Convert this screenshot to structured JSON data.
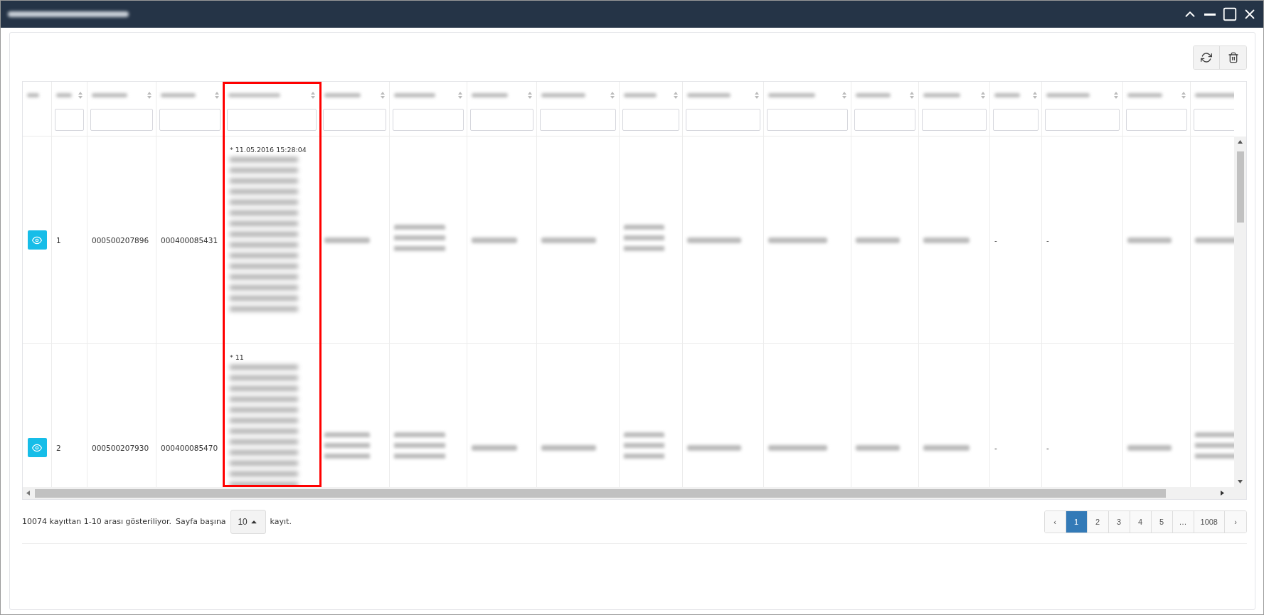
{
  "columns": [
    {
      "sortable": false,
      "filter": false,
      "highlighted": false
    },
    {
      "sortable": true,
      "filter": true,
      "highlighted": false
    },
    {
      "sortable": true,
      "filter": true,
      "highlighted": false
    },
    {
      "sortable": true,
      "filter": true,
      "highlighted": false
    },
    {
      "sortable": true,
      "filter": true,
      "highlighted": true
    },
    {
      "sortable": true,
      "filter": true,
      "highlighted": false
    },
    {
      "sortable": true,
      "filter": true,
      "highlighted": false
    },
    {
      "sortable": true,
      "filter": true,
      "highlighted": false
    },
    {
      "sortable": true,
      "filter": true,
      "highlighted": false
    },
    {
      "sortable": true,
      "filter": true,
      "highlighted": false
    },
    {
      "sortable": true,
      "filter": true,
      "highlighted": false
    },
    {
      "sortable": true,
      "filter": true,
      "highlighted": false
    },
    {
      "sortable": true,
      "filter": true,
      "highlighted": false
    },
    {
      "sortable": true,
      "filter": true,
      "highlighted": false
    },
    {
      "sortable": true,
      "filter": true,
      "highlighted": false
    },
    {
      "sortable": true,
      "filter": true,
      "highlighted": false
    },
    {
      "sortable": true,
      "filter": true,
      "highlighted": false
    },
    {
      "sortable": false,
      "filter": true,
      "highlighted": false
    }
  ],
  "rows": [
    {
      "cells": [
        {
          "kind": "view"
        },
        {
          "kind": "text",
          "text": "1"
        },
        {
          "kind": "text",
          "text": "000500207896"
        },
        {
          "kind": "text",
          "text": "000400085431"
        },
        {
          "kind": "note",
          "text": "* 11.05.2016 15:28:04"
        },
        {
          "kind": "blurred_line"
        },
        {
          "kind": "blurred_block"
        },
        {
          "kind": "blurred_line"
        },
        {
          "kind": "blurred_line"
        },
        {
          "kind": "blurred_block"
        },
        {
          "kind": "blurred_line"
        },
        {
          "kind": "blurred_line"
        },
        {
          "kind": "blurred_line"
        },
        {
          "kind": "blurred_line"
        },
        {
          "kind": "text",
          "text": "-"
        },
        {
          "kind": "text",
          "text": "-"
        },
        {
          "kind": "blurred_line"
        },
        {
          "kind": "blurred_line"
        }
      ]
    },
    {
      "cells": [
        {
          "kind": "view"
        },
        {
          "kind": "text",
          "text": "2"
        },
        {
          "kind": "text",
          "text": "000500207930"
        },
        {
          "kind": "text",
          "text": "000400085470"
        },
        {
          "kind": "note",
          "text": "* 11"
        },
        {
          "kind": "blurred_block"
        },
        {
          "kind": "blurred_block"
        },
        {
          "kind": "blurred_line"
        },
        {
          "kind": "blurred_line"
        },
        {
          "kind": "blurred_block"
        },
        {
          "kind": "blurred_line"
        },
        {
          "kind": "blurred_line"
        },
        {
          "kind": "blurred_line"
        },
        {
          "kind": "blurred_line"
        },
        {
          "kind": "text",
          "text": "-"
        },
        {
          "kind": "text",
          "text": "-"
        },
        {
          "kind": "blurred_line"
        },
        {
          "kind": "blurred_block"
        }
      ]
    }
  ],
  "footer": {
    "summary": "10074 kayıttan 1-10 arası gösteriliyor.",
    "per_page_label": "Sayfa başına",
    "per_page": "10",
    "per_page_suffix": "kayıt."
  },
  "pagination": [
    {
      "label": "‹",
      "selected": false
    },
    {
      "label": "1",
      "selected": true
    },
    {
      "label": "2",
      "selected": false
    },
    {
      "label": "3",
      "selected": false
    },
    {
      "label": "4",
      "selected": false
    },
    {
      "label": "5",
      "selected": false
    },
    {
      "label": "…",
      "selected": false
    },
    {
      "label": "1008",
      "selected": false
    },
    {
      "label": "›",
      "selected": false
    }
  ]
}
